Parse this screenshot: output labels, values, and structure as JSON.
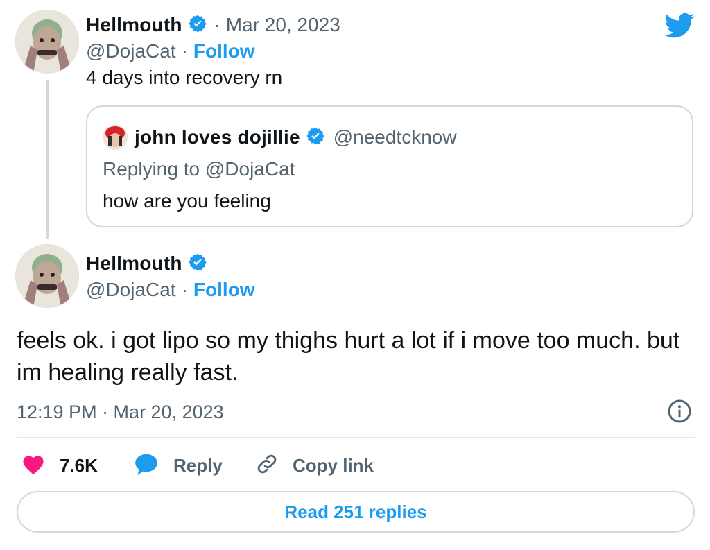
{
  "tweet": {
    "author_name": "Hellmouth",
    "date_meta": "· Mar 20, 2023",
    "handle": "@DojaCat",
    "separator": "·",
    "follow_label": "Follow",
    "text": "4 days into recovery rn"
  },
  "quoted": {
    "author_name": "john loves dojillie",
    "handle": "@needtcknow",
    "replying_to": "Replying to @DojaCat",
    "text": "how are you feeling"
  },
  "reply": {
    "author_name": "Hellmouth",
    "handle": "@DojaCat",
    "separator": "·",
    "follow_label": "Follow",
    "text": "feels ok. i got lipo so my thighs hurt a lot if i move too much. but im healing really fast.",
    "timestamp": "12:19 PM · Mar 20, 2023"
  },
  "actions": {
    "like_count": "7.6K",
    "reply_label": "Reply",
    "copy_label": "Copy link",
    "read_replies_label": "Read 251 replies"
  },
  "colors": {
    "accent": "#1d9bf0",
    "like": "#f91880",
    "muted": "#536471",
    "border": "#cfd9de"
  },
  "icons": [
    "twitter-bird-icon",
    "verified-badge-icon",
    "info-icon",
    "heart-icon",
    "reply-bubble-icon",
    "link-icon"
  ]
}
